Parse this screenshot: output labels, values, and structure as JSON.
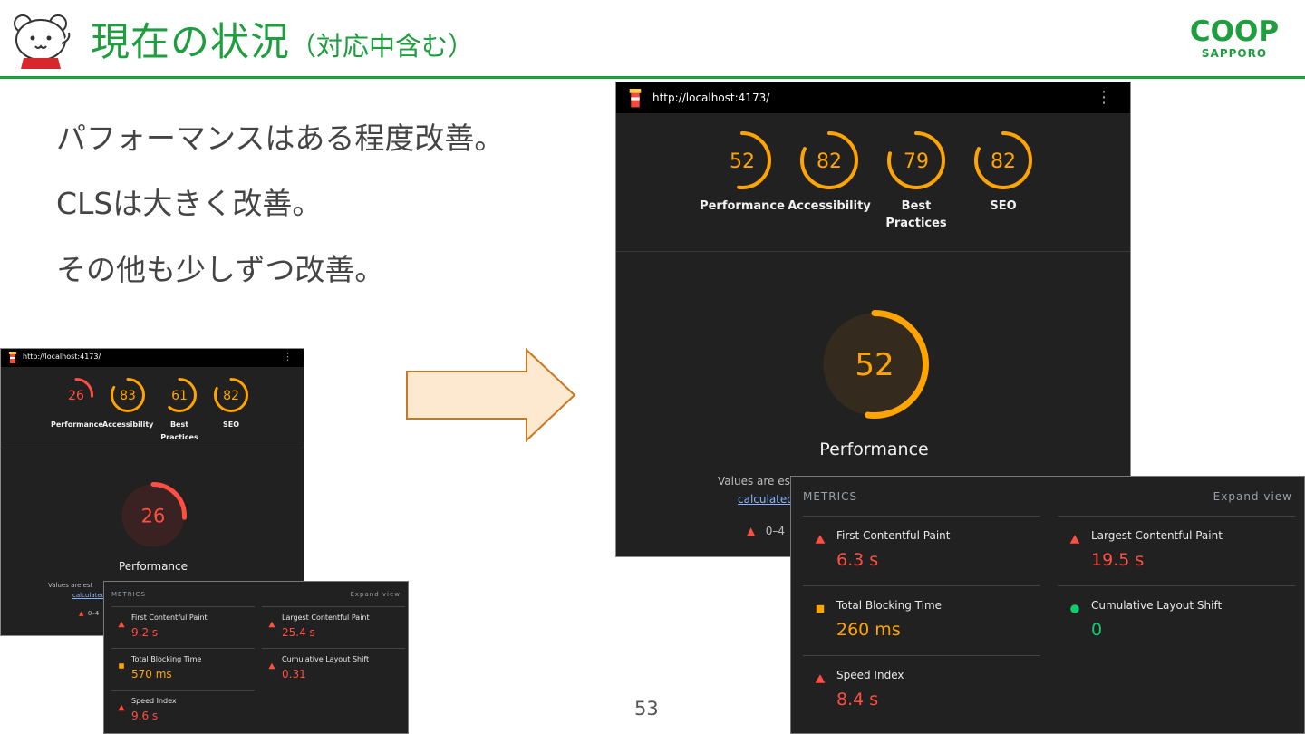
{
  "slide": {
    "title": "現在の状況",
    "title_sub": "（対応中含む）",
    "logo_main": "COOP",
    "logo_sub": "SAPPORO",
    "bullets": [
      "パフォーマンスはある程度改善。",
      "CLSは大きく改善。",
      "その他も少しずつ改善。"
    ],
    "page_number": "53",
    "accent_color": "#1e9e3e"
  },
  "before": {
    "url": "http://localhost:4173/",
    "scores": [
      {
        "value": "26",
        "label1": "Performance",
        "label2": "",
        "score": 26,
        "color": "#ff4e42"
      },
      {
        "value": "83",
        "label1": "Accessibility",
        "label2": "",
        "score": 83,
        "color": "#ffa400"
      },
      {
        "value": "61",
        "label1": "Best",
        "label2": "Practices",
        "score": 61,
        "color": "#ffa400"
      },
      {
        "value": "82",
        "label1": "SEO",
        "label2": "",
        "score": 82,
        "color": "#ffa400"
      }
    ],
    "main_score": {
      "value": "26",
      "label": "Performance",
      "score": 26,
      "color": "#ff4e42"
    },
    "values_text": "Values are est",
    "calc_link": "calculated",
    "legend_text": "0–4",
    "metrics": {
      "header": "METRICS",
      "expand": "Expand view",
      "items": [
        {
          "label": "First Contentful Paint",
          "value": "9.2 s",
          "icon": "triangle",
          "color": "#ff4e42"
        },
        {
          "label": "Largest Contentful Paint",
          "value": "25.4 s",
          "icon": "triangle",
          "color": "#ff4e42"
        },
        {
          "label": "Total Blocking Time",
          "value": "570 ms",
          "icon": "square",
          "color": "#ffa400"
        },
        {
          "label": "Cumulative Layout Shift",
          "value": "0.31",
          "icon": "triangle",
          "color": "#ff4e42"
        },
        {
          "label": "Speed Index",
          "value": "9.6 s",
          "icon": "triangle",
          "color": "#ff4e42"
        }
      ]
    }
  },
  "after": {
    "url": "http://localhost:4173/",
    "scores": [
      {
        "value": "52",
        "label1": "Performance",
        "label2": "",
        "score": 52,
        "color": "#ffa400"
      },
      {
        "value": "82",
        "label1": "Accessibility",
        "label2": "",
        "score": 82,
        "color": "#ffa400"
      },
      {
        "value": "79",
        "label1": "Best",
        "label2": "Practices",
        "score": 79,
        "color": "#ffa400"
      },
      {
        "value": "82",
        "label1": "SEO",
        "label2": "",
        "score": 82,
        "color": "#ffa400"
      }
    ],
    "main_score": {
      "value": "52",
      "label": "Performance",
      "score": 52,
      "color": "#ffa400"
    },
    "values_text": "Values are est",
    "calc_link": "calculated",
    "legend_text": "0–4",
    "metrics": {
      "header": "METRICS",
      "expand": "Expand view",
      "items": [
        {
          "label": "First Contentful Paint",
          "value": "6.3 s",
          "icon": "triangle",
          "color": "#ff4e42"
        },
        {
          "label": "Largest Contentful Paint",
          "value": "19.5 s",
          "icon": "triangle",
          "color": "#ff4e42"
        },
        {
          "label": "Total Blocking Time",
          "value": "260 ms",
          "icon": "square",
          "color": "#ffa400"
        },
        {
          "label": "Cumulative Layout Shift",
          "value": "0",
          "icon": "circle",
          "color": "#0cce6b"
        },
        {
          "label": "Speed Index",
          "value": "8.4 s",
          "icon": "triangle",
          "color": "#ff4e42"
        }
      ]
    }
  }
}
